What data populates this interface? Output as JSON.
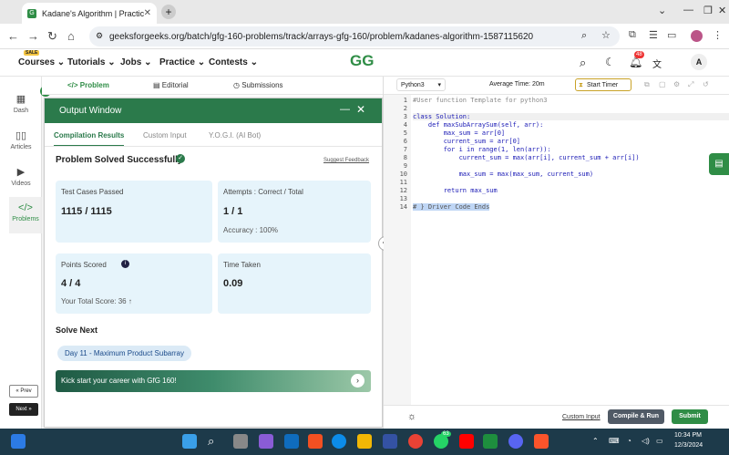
{
  "browser": {
    "tab_title": "Kadane's Algorithm | Practice |",
    "url": "geeksforgeeks.org/batch/gfg-160-problems/track/arrays-gfg-160/problem/kadanes-algorithm-1587115620"
  },
  "nav": {
    "sale_badge": "SALE",
    "items": [
      "Courses",
      "Tutorials",
      "Jobs",
      "Practice",
      "Contests"
    ],
    "logo": "GG",
    "notif_count": "48",
    "avatar": "A"
  },
  "rail": {
    "items": [
      "Dash",
      "Articles",
      "Videos",
      "Problems"
    ],
    "prev": "« Prev",
    "next": "Next »"
  },
  "problem_tabs": [
    "Problem",
    "Editorial",
    "Submissions"
  ],
  "output": {
    "title": "Output Window",
    "tabs": [
      "Compilation Results",
      "Custom Input",
      "Y.O.G.I. (AI Bot)"
    ],
    "status": "Problem Solved Successfully",
    "suggest": "Suggest Feedback",
    "tests_label": "Test Cases Passed",
    "tests_value": "1115 / 1115",
    "attempts_label": "Attempts : Correct / Total",
    "attempts_value": "1 / 1",
    "accuracy": "Accuracy : 100%",
    "points_label": "Points Scored",
    "points_value": "4 / 4",
    "total_score": "Your Total Score: 36 ↑",
    "time_label": "Time Taken",
    "time_value": "0.09",
    "solve_next": "Solve Next",
    "next_problem": "Day 11 - Maximum Product Subarray",
    "banner": "Kick start your career with GfG 160!"
  },
  "editor": {
    "language": "Python3",
    "avg_time": "Average Time: 20m",
    "timer": "Start Timer",
    "lines": [
      "#User function Template for python3",
      "",
      "class Solution:",
      "    def maxSubArraySum(self, arr):",
      "        max_sum = arr[0]",
      "        current_sum = arr[0]",
      "        for i in range(1, len(arr)):",
      "            current_sum = max(arr[i], current_sum + arr[i])",
      "",
      "            max_sum = max(max_sum, current_sum)",
      "",
      "        return max_sum",
      "",
      "# } Driver Code Ends"
    ],
    "line_numbers": [
      "1",
      "2",
      "3",
      "4",
      "5",
      "6",
      "7",
      "8",
      "9",
      "10",
      "11",
      "12",
      "13",
      "14"
    ],
    "custom_input": "Custom Input",
    "compile": "Compile & Run",
    "submit": "Submit"
  },
  "taskbar": {
    "time": "10:34 PM",
    "date": "12/3/2024",
    "badge": "63"
  },
  "colors": {
    "green": "#2f8d46",
    "header_green": "#2b7a4b",
    "card_blue": "#e6f4fb"
  }
}
